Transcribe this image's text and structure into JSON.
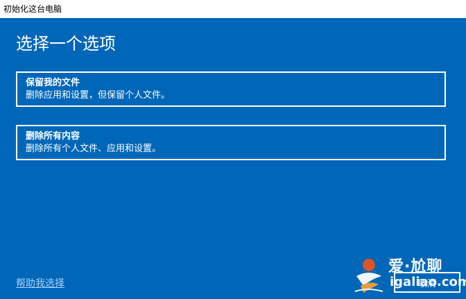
{
  "window": {
    "title": "初始化这台电脑"
  },
  "page": {
    "heading": "选择一个选项"
  },
  "options": [
    {
      "title": "保留我的文件",
      "description": "删除应用和设置，但保留个人文件。"
    },
    {
      "title": "删除所有内容",
      "description": "删除所有个人文件、应用和设置。"
    }
  ],
  "footer": {
    "help_link": "帮助我选择",
    "cancel_label": "取消"
  },
  "watermark": {
    "line1": "爱·尬聊",
    "line2": "igaliao.com"
  },
  "colors": {
    "background": "#0067b8",
    "text": "#ffffff",
    "link": "#a8d0f4"
  }
}
